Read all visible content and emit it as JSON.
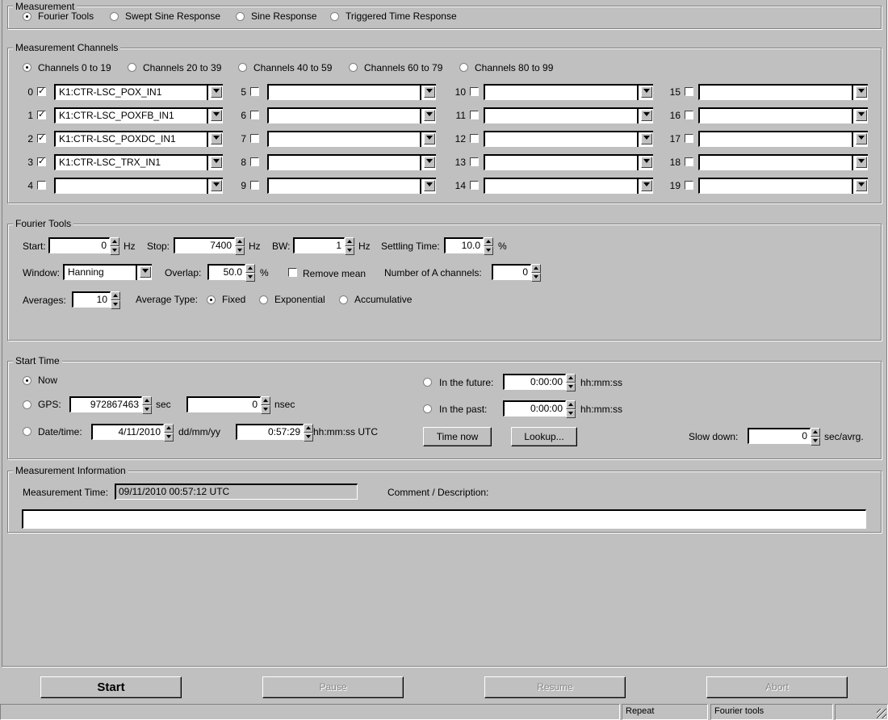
{
  "measurement": {
    "legend": "Measurement",
    "options": [
      "Fourier Tools",
      "Swept Sine Response",
      "Sine Response",
      "Triggered Time Response"
    ],
    "selected": 0
  },
  "channels": {
    "legend": "Measurement Channels",
    "ranges": [
      "Channels 0 to 19",
      "Channels 20 to 39",
      "Channels 40 to 59",
      "Channels 60 to 79",
      "Channels 80 to 99"
    ],
    "selected_range": 0,
    "list": [
      {
        "num": "0",
        "checked": true,
        "value": "K1:CTR-LSC_POX_IN1"
      },
      {
        "num": "1",
        "checked": true,
        "value": "K1:CTR-LSC_POXFB_IN1"
      },
      {
        "num": "2",
        "checked": true,
        "value": "K1:CTR-LSC_POXDC_IN1"
      },
      {
        "num": "3",
        "checked": true,
        "value": "K1:CTR-LSC_TRX_IN1"
      },
      {
        "num": "4",
        "checked": false,
        "value": ""
      },
      {
        "num": "5",
        "checked": false,
        "value": ""
      },
      {
        "num": "6",
        "checked": false,
        "value": ""
      },
      {
        "num": "7",
        "checked": false,
        "value": ""
      },
      {
        "num": "8",
        "checked": false,
        "value": ""
      },
      {
        "num": "9",
        "checked": false,
        "value": ""
      },
      {
        "num": "10",
        "checked": false,
        "value": ""
      },
      {
        "num": "11",
        "checked": false,
        "value": ""
      },
      {
        "num": "12",
        "checked": false,
        "value": ""
      },
      {
        "num": "13",
        "checked": false,
        "value": ""
      },
      {
        "num": "14",
        "checked": false,
        "value": ""
      },
      {
        "num": "15",
        "checked": false,
        "value": ""
      },
      {
        "num": "16",
        "checked": false,
        "value": ""
      },
      {
        "num": "17",
        "checked": false,
        "value": ""
      },
      {
        "num": "18",
        "checked": false,
        "value": ""
      },
      {
        "num": "19",
        "checked": false,
        "value": ""
      }
    ]
  },
  "fourier": {
    "legend": "Fourier Tools",
    "start_label": "Start:",
    "start": "0",
    "hz": "Hz",
    "stop_label": "Stop:",
    "stop": "7400",
    "bw_label": "BW:",
    "bw": "1",
    "settling_label": "Settling Time:",
    "settling": "10.0",
    "pct": "%",
    "window_label": "Window:",
    "window": "Hanning",
    "overlap_label": "Overlap:",
    "overlap": "50.0",
    "remove_mean": "Remove mean",
    "remove_mean_checked": false,
    "numA_label": "Number of A channels:",
    "numA": "0",
    "averages_label": "Averages:",
    "averages": "10",
    "avgtype_label": "Average Type:",
    "avgtypes": [
      "Fixed",
      "Exponential",
      "Accumulative"
    ],
    "avgtype_selected": 0
  },
  "start_time": {
    "legend": "Start Time",
    "now": "Now",
    "gps": "GPS:",
    "gps_sec": "972867463",
    "sec": "sec",
    "gps_nsec": "0",
    "nsec": "nsec",
    "datetime": "Date/time:",
    "date": "4/11/2010",
    "date_fmt": "dd/mm/yy",
    "time": "0:57:29",
    "time_fmt": "hh:mm:ss  UTC",
    "future": "In the future:",
    "future_val": "0:00:00",
    "past": "In the past:",
    "past_val": "0:00:00",
    "hms": "hh:mm:ss",
    "time_now": "Time now",
    "lookup": "Lookup...",
    "slow_label": "Slow down:",
    "slow": "0",
    "slow_unit": "sec/avrg.",
    "selected": "Now"
  },
  "info": {
    "legend": "Measurement Information",
    "mtime_label": "Measurement Time:",
    "mtime": "09/11/2010 00:57:12  UTC",
    "comment_label": "Comment / Description:",
    "comment": ""
  },
  "buttons": {
    "start": "Start",
    "pause": "Pause",
    "resume": "Resume",
    "abort": "Abort"
  },
  "status": {
    "main": "",
    "repeat": "Repeat",
    "mode": "Fourier tools",
    "extra": ""
  }
}
